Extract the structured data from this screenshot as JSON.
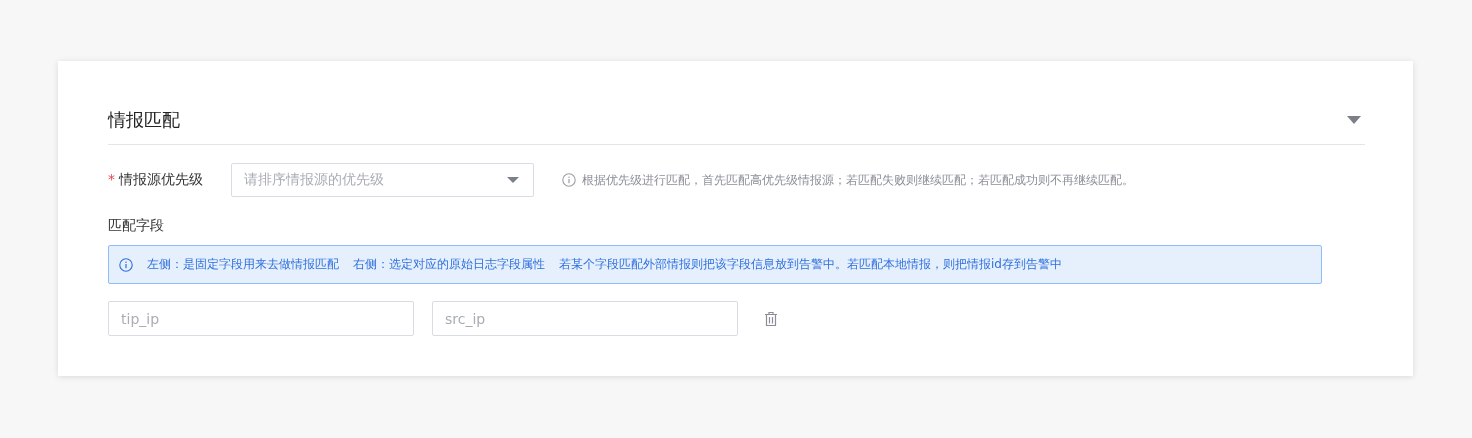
{
  "section": {
    "title": "情报匹配",
    "expanded": true
  },
  "priority_field": {
    "label": "情报源优先级",
    "required_mark": "*",
    "placeholder": "请排序情报源的优先级",
    "hint": "根据优先级进行匹配，首先匹配高优先级情报源；若匹配失败则继续匹配；若匹配成功则不再继续匹配。"
  },
  "match_fields": {
    "label": "匹配字段",
    "notice": [
      "左侧：是固定字段用来去做情报匹配",
      "右侧：选定对应的原始日志字段属性",
      "若某个字段匹配外部情报则把该字段信息放到告警中。若匹配本地情报，则把情报id存到告警中"
    ],
    "rows": [
      {
        "left_placeholder": "tip_ip",
        "right_placeholder": "src_ip"
      }
    ]
  }
}
